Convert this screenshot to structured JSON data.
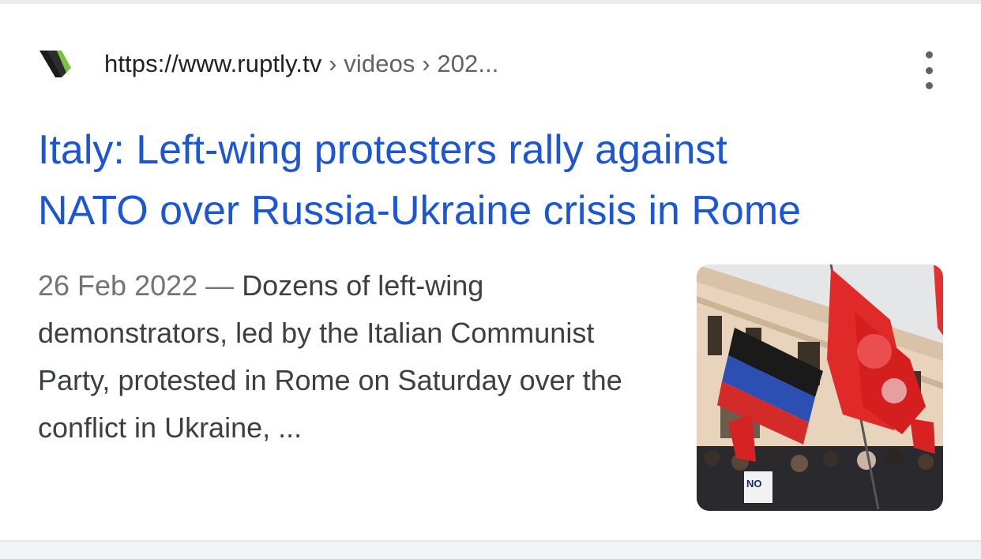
{
  "result": {
    "favicon": "ruptly-logo-icon",
    "url": {
      "domain": "https://www.ruptly.tv",
      "breadcrumb": " › videos › 202..."
    },
    "menu_icon": "more-vert-icon",
    "title_line1": "Italy: Left-wing protesters rally against",
    "title_line2": "NATO over Russia-Ukraine crisis in Rome",
    "snippet": {
      "date": "26 Feb 2022",
      "separator": " — ",
      "text": "Dozens of left-wing demonstrators, led by the Italian Communist Party, protested in Rome on Saturday over the conflict in Ukraine, ..."
    },
    "thumbnail": {
      "sign_text": "NO"
    }
  },
  "colors": {
    "title_link": "#1a56d6",
    "url_text": "#202124",
    "snippet_text": "#3c4043",
    "date_text": "#70757a",
    "divider": "#f1f3f4"
  }
}
